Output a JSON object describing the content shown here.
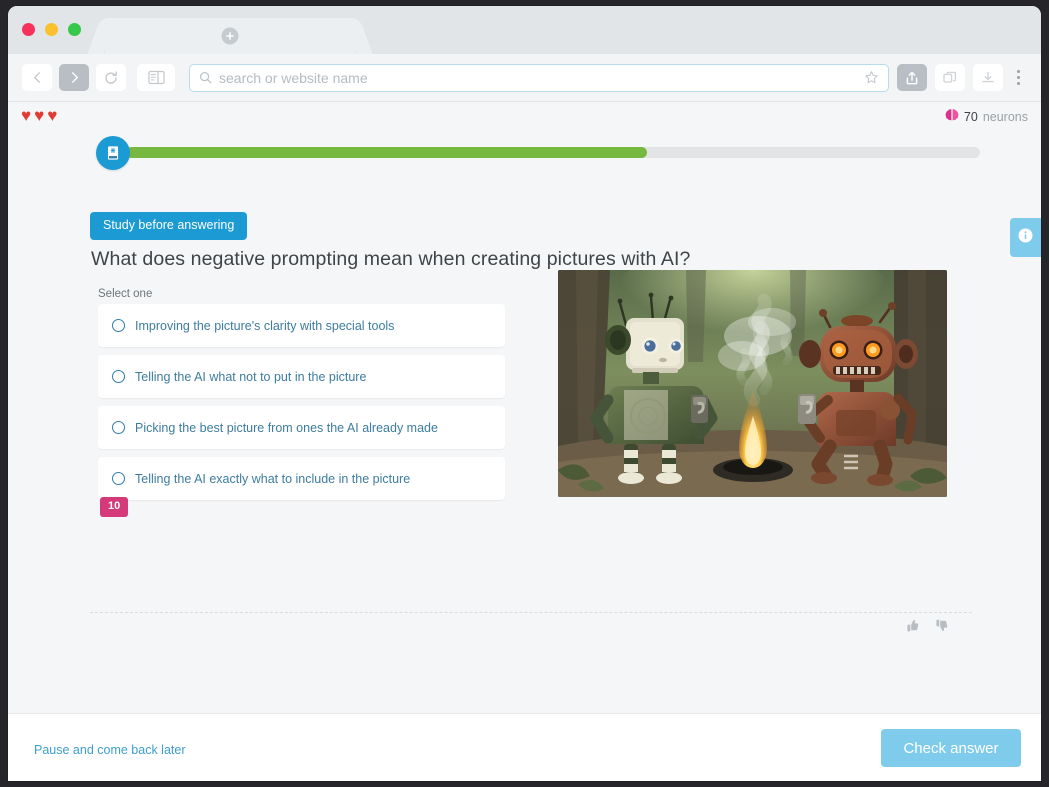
{
  "browser": {
    "traffic_lights": [
      "close",
      "minimize",
      "zoom"
    ],
    "tab": {
      "title": "",
      "new_tab_icon": "plus-circle-icon"
    },
    "toolbar": {
      "back_label": "Back",
      "forward_label": "Forward",
      "reload_label": "Reload",
      "sidebar_label": "Show sidebar",
      "share_label": "Share",
      "tab_overview_label": "Tab overview",
      "downloads_label": "Downloads",
      "menu_label": "More"
    },
    "address": {
      "value": "",
      "placeholder": "search or website name",
      "search_icon": "search-icon",
      "bookmark_icon": "star-icon"
    }
  },
  "status": {
    "hearts": "♥♥♥",
    "hearts_count": 3,
    "neurons_count": "70",
    "neurons_label": "neurons",
    "neurons_icon": "brain-icon",
    "neurons_color": "#d9328c"
  },
  "progress": {
    "badge_icon": "course-card-icon",
    "badge_color": "#1b9ad4",
    "percent": 61,
    "fill_color": "#76b840",
    "track_color": "#e2e4e6"
  },
  "info_tab": {
    "icon": "info-icon",
    "color": "#7fcbeb"
  },
  "lesson": {
    "study_chip_label": "Study before answering",
    "study_chip_color": "#1b9ad4",
    "question": "What does negative prompting mean when creating pictures with AI?",
    "select_hint": "Select one",
    "answers": [
      {
        "label": "Improving the picture's clarity with special tools",
        "selected": false
      },
      {
        "label": "Telling the AI what not to put in the picture",
        "selected": false
      },
      {
        "label": "Picking the best picture from ones the AI already made",
        "selected": false
      },
      {
        "label": "Telling the AI exactly what to include in the picture",
        "selected": false
      }
    ],
    "points_badge": "10",
    "points_badge_color": "#d43a79",
    "image_alt": "Two robots drinking coffee by a campfire in a forest"
  },
  "feedback": {
    "thumbs_up_icon": "thumbs-up-icon",
    "thumbs_down_icon": "thumbs-down-icon"
  },
  "footer": {
    "pause_label": "Pause and come back later",
    "check_label": "Check answer",
    "check_color": "#7fcbeb"
  }
}
